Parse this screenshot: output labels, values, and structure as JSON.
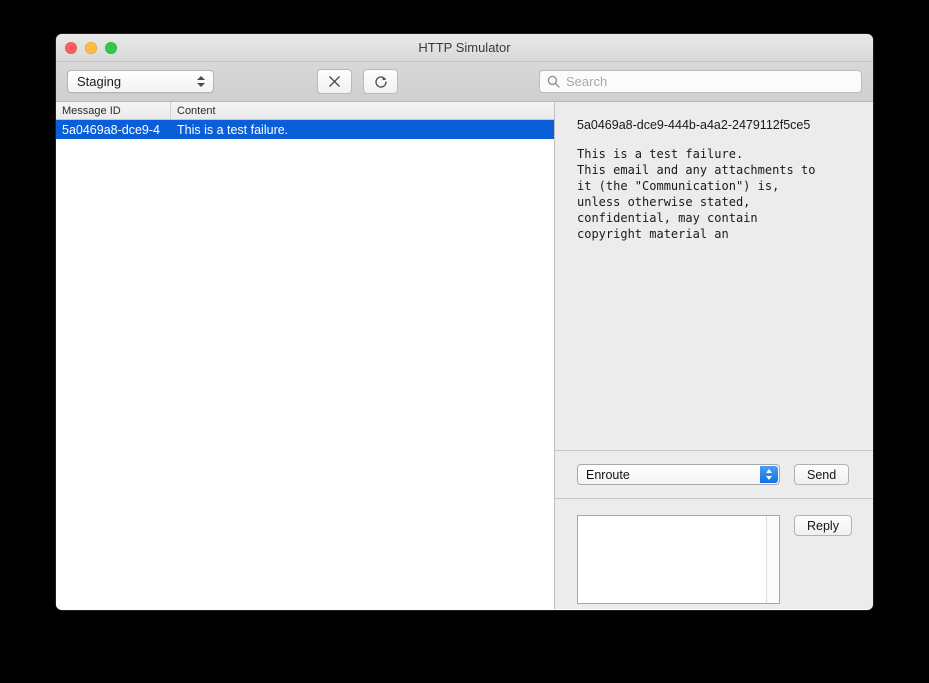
{
  "window": {
    "title": "HTTP Simulator",
    "traffic_lights": [
      {
        "name": "close",
        "color": "#fc605c"
      },
      {
        "name": "minimize",
        "color": "#fdbc40"
      },
      {
        "name": "zoom",
        "color": "#34c84a"
      }
    ]
  },
  "toolbar": {
    "environment": {
      "selected": "Staging",
      "options": [
        "Staging"
      ]
    },
    "clear_button": {
      "icon": "close-x-icon",
      "label": ""
    },
    "reload_button": {
      "icon": "refresh-icon",
      "label": ""
    },
    "search": {
      "icon": "search-icon",
      "placeholder": "Search",
      "value": ""
    }
  },
  "table": {
    "columns": [
      "Message ID",
      "Content"
    ],
    "rows": [
      {
        "id": "5a0469a8-dce9-4",
        "content": "This is a test failure.",
        "selected": true
      }
    ]
  },
  "detail": {
    "message_id": "5a0469a8-dce9-444b-a4a2-2479112f5ce5",
    "body": "This is a test failure.\nThis email and any attachments to\nit (the \"Communication\") is,\nunless otherwise stated,\nconfidential, may contain\ncopyright material an"
  },
  "send_row": {
    "status": {
      "selected": "Enroute",
      "options": [
        "Enroute"
      ]
    },
    "send_label": "Send"
  },
  "reply_row": {
    "textarea_value": "",
    "reply_label": "Reply"
  },
  "colors": {
    "selection_blue": "#0a5fd9",
    "popup_arrow_blue": "#0e72e8",
    "detail_background": "#ececec",
    "window_background": "#ffffff"
  }
}
